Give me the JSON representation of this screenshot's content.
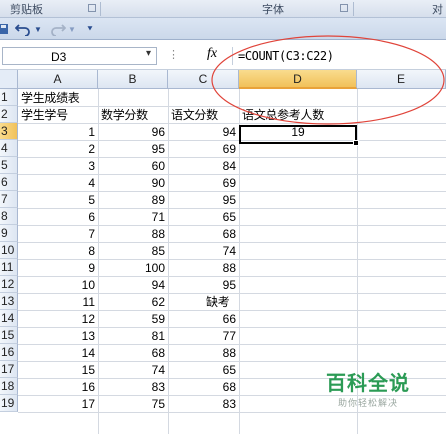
{
  "ribbon": {
    "groups": [
      "剪贴板",
      "字体",
      "对"
    ]
  },
  "qat": {
    "undo_icon": "undo-icon",
    "redo_icon": "redo-icon",
    "customize_icon": "customize-icon"
  },
  "formula_bar": {
    "name_box": "D3",
    "fx": "fx",
    "formula": "=COUNT(C3:C22)"
  },
  "columns": [
    "A",
    "B",
    "C",
    "D",
    "E"
  ],
  "selected_column": "D",
  "rows": [
    "1",
    "2",
    "3",
    "4",
    "5",
    "6",
    "7",
    "8",
    "9",
    "10",
    "11",
    "12",
    "13",
    "14",
    "15",
    "16",
    "17",
    "18",
    "19"
  ],
  "selected_row": "3",
  "sheet": {
    "title": "学生成绩表",
    "headers": [
      "学生学号",
      "数学分数",
      "语文分数",
      "语文总参考人数"
    ],
    "result": "19",
    "records": [
      {
        "id": "1",
        "math": "96",
        "chinese": "94"
      },
      {
        "id": "2",
        "math": "95",
        "chinese": "69"
      },
      {
        "id": "3",
        "math": "60",
        "chinese": "84"
      },
      {
        "id": "4",
        "math": "90",
        "chinese": "69"
      },
      {
        "id": "5",
        "math": "89",
        "chinese": "95"
      },
      {
        "id": "6",
        "math": "71",
        "chinese": "65"
      },
      {
        "id": "7",
        "math": "88",
        "chinese": "68"
      },
      {
        "id": "8",
        "math": "85",
        "chinese": "74"
      },
      {
        "id": "9",
        "math": "100",
        "chinese": "88"
      },
      {
        "id": "10",
        "math": "94",
        "chinese": "95"
      },
      {
        "id": "11",
        "math": "62",
        "chinese": "缺考"
      },
      {
        "id": "12",
        "math": "59",
        "chinese": "66"
      },
      {
        "id": "13",
        "math": "81",
        "chinese": "77"
      },
      {
        "id": "14",
        "math": "68",
        "chinese": "88"
      },
      {
        "id": "15",
        "math": "74",
        "chinese": "65"
      },
      {
        "id": "16",
        "math": "83",
        "chinese": "68"
      },
      {
        "id": "17",
        "math": "75",
        "chinese": "83"
      }
    ]
  },
  "watermark": {
    "title": "百科全说",
    "subtitle": "助你轻松解决"
  },
  "colors": {
    "annotation": "#e0443a",
    "selection_header": "#f1c15a",
    "watermark": "#2b9b55"
  }
}
